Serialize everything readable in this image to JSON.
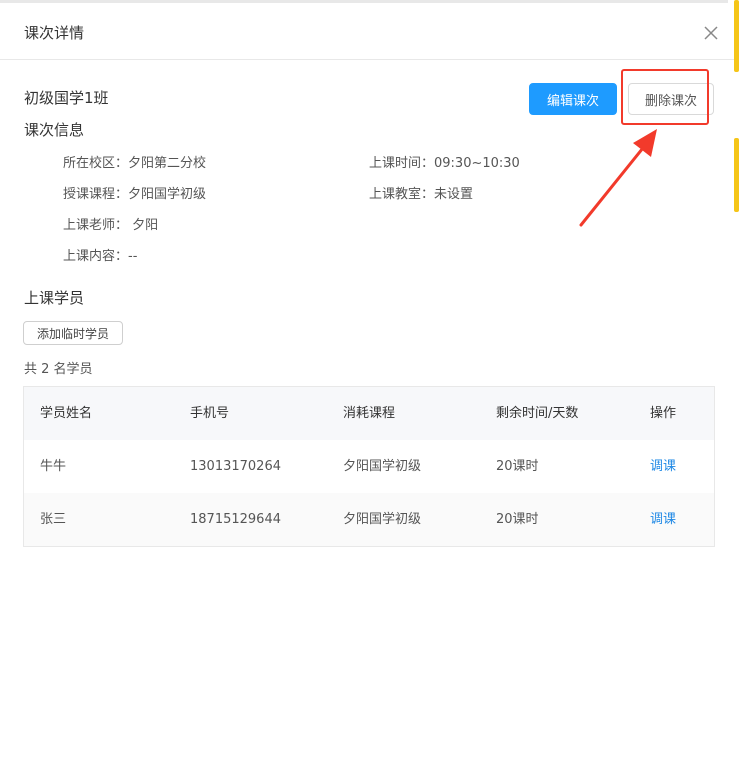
{
  "dialog": {
    "title": "课次详情"
  },
  "lesson": {
    "class_name": "初级国学1班",
    "edit_label": "编辑课次",
    "delete_label": "删除课次"
  },
  "info": {
    "section_title": "课次信息",
    "campus": "所在校区：夕阳第二分校",
    "time": "上课时间：09:30~10:30",
    "course": "授课课程：夕阳国学初级",
    "room": "上课教室：未设置",
    "teacher": "上课老师： 夕阳",
    "content": "上课内容：--"
  },
  "students": {
    "section_title": "上课学员",
    "add_label": "添加临时学员",
    "count_text": "共 2 名学员",
    "columns": [
      "学员姓名",
      "手机号",
      "消耗课程",
      "剩余时间/天数",
      "操作"
    ],
    "rows": [
      {
        "name": "牛牛",
        "phone": "13013170264",
        "course": "夕阳国学初级",
        "remaining": "20课时",
        "action": "调课"
      },
      {
        "name": "张三",
        "phone": "18715129644",
        "course": "夕阳国学初级",
        "remaining": "20课时",
        "action": "调课"
      }
    ]
  },
  "colors": {
    "primary": "#1e9bff",
    "annotation": "#f23a2b",
    "link": "#1e88e5"
  }
}
